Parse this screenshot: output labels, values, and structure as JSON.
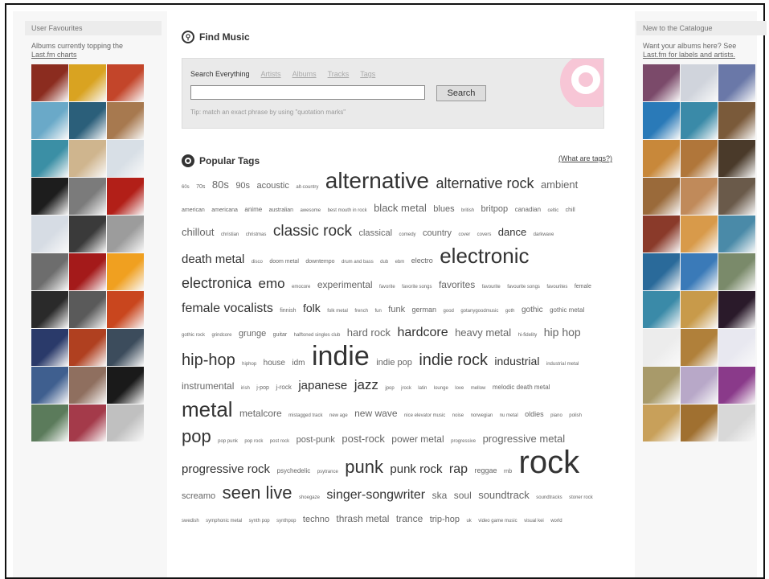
{
  "left": {
    "heading": "User Favourites",
    "text": "Albums currently topping the",
    "link": "Last.fm charts",
    "covers": [
      "#8b2c1f",
      "#d9a321",
      "#c3452a",
      "#6aa9c8",
      "#2b5f7a",
      "#a7794f",
      "#3b8fa5",
      "#cfb58e",
      "#d8dfe6",
      "#1d1d1d",
      "#7b7b7b",
      "#b21f18",
      "#d6dce4",
      "#3a3a3a",
      "#9c9c9c",
      "#6d6d6d",
      "#a41a1a",
      "#f0a020",
      "#2a2a2a",
      "#5a5a5a",
      "#c9461e",
      "#2a3a6a",
      "#b04020",
      "#3c4c5c",
      "#3f5f8f",
      "#8f6f5f",
      "#1a1a1a",
      "#5b7b5b",
      "#a43a4a",
      "#c0c0c0"
    ]
  },
  "center": {
    "find_title": "Find Music",
    "tabs": [
      "Search Everything",
      "Artists",
      "Albums",
      "Tracks",
      "Tags"
    ],
    "search_value": "",
    "search_button": "Search",
    "tip": "Tip: match an exact phrase by using \"quotation marks\"",
    "tags_title": "Popular Tags",
    "what_link": "(What are tags?)",
    "tags": [
      {
        "t": "60s",
        "s": 6
      },
      {
        "t": "70s",
        "s": 7
      },
      {
        "t": "80s",
        "s": 13
      },
      {
        "t": "90s",
        "s": 11
      },
      {
        "t": "acoustic",
        "s": 11
      },
      {
        "t": "alt-country",
        "s": 6
      },
      {
        "t": "alternative",
        "s": 28,
        "d": 1
      },
      {
        "t": "alternative rock",
        "s": 18,
        "d": 1
      },
      {
        "t": "ambient",
        "s": 13
      },
      {
        "t": "american",
        "s": 7
      },
      {
        "t": "americana",
        "s": 7
      },
      {
        "t": "anime",
        "s": 8
      },
      {
        "t": "australian",
        "s": 7
      },
      {
        "t": "awesome",
        "s": 6
      },
      {
        "t": "best mouth in rock",
        "s": 6
      },
      {
        "t": "black metal",
        "s": 13
      },
      {
        "t": "blues",
        "s": 11
      },
      {
        "t": "british",
        "s": 6
      },
      {
        "t": "britpop",
        "s": 11
      },
      {
        "t": "canadian",
        "s": 8
      },
      {
        "t": "celtic",
        "s": 6
      },
      {
        "t": "chill",
        "s": 7
      },
      {
        "t": "chillout",
        "s": 13
      },
      {
        "t": "christian",
        "s": 6
      },
      {
        "t": "christmas",
        "s": 6
      },
      {
        "t": "classic rock",
        "s": 19,
        "d": 1
      },
      {
        "t": "classical",
        "s": 11
      },
      {
        "t": "comedy",
        "s": 6
      },
      {
        "t": "country",
        "s": 11
      },
      {
        "t": "cover",
        "s": 6
      },
      {
        "t": "covers",
        "s": 6
      },
      {
        "t": "dance",
        "s": 13,
        "d": 1
      },
      {
        "t": "darkwave",
        "s": 6
      },
      {
        "t": "death metal",
        "s": 15,
        "d": 1
      },
      {
        "t": "disco",
        "s": 6
      },
      {
        "t": "doom metal",
        "s": 7
      },
      {
        "t": "downtempo",
        "s": 7
      },
      {
        "t": "drum and bass",
        "s": 6
      },
      {
        "t": "dub",
        "s": 6
      },
      {
        "t": "ebm",
        "s": 6
      },
      {
        "t": "electro",
        "s": 9
      },
      {
        "t": "electronic",
        "s": 26,
        "d": 1
      },
      {
        "t": "electronica",
        "s": 18,
        "d": 1
      },
      {
        "t": "emo",
        "s": 17,
        "d": 1
      },
      {
        "t": "emocore",
        "s": 6
      },
      {
        "t": "experimental",
        "s": 12
      },
      {
        "t": "favorite",
        "s": 6
      },
      {
        "t": "favorite songs",
        "s": 6
      },
      {
        "t": "favorites",
        "s": 12
      },
      {
        "t": "favourite",
        "s": 6
      },
      {
        "t": "favourite songs",
        "s": 6
      },
      {
        "t": "favourites",
        "s": 6
      },
      {
        "t": "female",
        "s": 7
      },
      {
        "t": "female vocalists",
        "s": 16,
        "d": 1
      },
      {
        "t": "finnish",
        "s": 7
      },
      {
        "t": "folk",
        "s": 14,
        "d": 1
      },
      {
        "t": "folk metal",
        "s": 6
      },
      {
        "t": "french",
        "s": 6
      },
      {
        "t": "fun",
        "s": 6
      },
      {
        "t": "funk",
        "s": 11
      },
      {
        "t": "german",
        "s": 9
      },
      {
        "t": "good",
        "s": 6
      },
      {
        "t": "gotanygoodmusic",
        "s": 6
      },
      {
        "t": "goth",
        "s": 6
      },
      {
        "t": "gothic",
        "s": 10
      },
      {
        "t": "gothic metal",
        "s": 8
      },
      {
        "t": "gothic rock",
        "s": 6
      },
      {
        "t": "grindcore",
        "s": 6
      },
      {
        "t": "grunge",
        "s": 11
      },
      {
        "t": "guitar",
        "s": 7
      },
      {
        "t": "halftoned singles club",
        "s": 6
      },
      {
        "t": "hard rock",
        "s": 13
      },
      {
        "t": "hardcore",
        "s": 16,
        "d": 1
      },
      {
        "t": "heavy metal",
        "s": 13
      },
      {
        "t": "hi-fidelity",
        "s": 6
      },
      {
        "t": "hip hop",
        "s": 14
      },
      {
        "t": "hip-hop",
        "s": 20,
        "d": 1
      },
      {
        "t": "hiphop",
        "s": 6
      },
      {
        "t": "house",
        "s": 10
      },
      {
        "t": "idm",
        "s": 10
      },
      {
        "t": "indie",
        "s": 34,
        "d": 1
      },
      {
        "t": "indie pop",
        "s": 11
      },
      {
        "t": "indie rock",
        "s": 20,
        "d": 1
      },
      {
        "t": "industrial",
        "s": 14,
        "d": 1
      },
      {
        "t": "industrial metal",
        "s": 6
      },
      {
        "t": "instrumental",
        "s": 12
      },
      {
        "t": "irish",
        "s": 6
      },
      {
        "t": "j-pop",
        "s": 7
      },
      {
        "t": "j-rock",
        "s": 8
      },
      {
        "t": "japanese",
        "s": 15,
        "d": 1
      },
      {
        "t": "jazz",
        "s": 17,
        "d": 1
      },
      {
        "t": "jpop",
        "s": 6
      },
      {
        "t": "jrock",
        "s": 6
      },
      {
        "t": "latin",
        "s": 6
      },
      {
        "t": "lounge",
        "s": 6
      },
      {
        "t": "love",
        "s": 6
      },
      {
        "t": "mellow",
        "s": 6
      },
      {
        "t": "melodic death metal",
        "s": 8
      },
      {
        "t": "metal",
        "s": 26,
        "d": 1
      },
      {
        "t": "metalcore",
        "s": 12
      },
      {
        "t": "mistagged track",
        "s": 6
      },
      {
        "t": "new age",
        "s": 6
      },
      {
        "t": "new wave",
        "s": 12
      },
      {
        "t": "nice elevator music",
        "s": 6
      },
      {
        "t": "noise",
        "s": 6
      },
      {
        "t": "norwegian",
        "s": 6
      },
      {
        "t": "nu metal",
        "s": 6
      },
      {
        "t": "oldies",
        "s": 9
      },
      {
        "t": "piano",
        "s": 6
      },
      {
        "t": "polish",
        "s": 6
      },
      {
        "t": "pop",
        "s": 22,
        "d": 1
      },
      {
        "t": "pop punk",
        "s": 6
      },
      {
        "t": "pop rock",
        "s": 6
      },
      {
        "t": "post rock",
        "s": 6
      },
      {
        "t": "post-punk",
        "s": 11
      },
      {
        "t": "post-rock",
        "s": 13
      },
      {
        "t": "power metal",
        "s": 12
      },
      {
        "t": "progressive",
        "s": 6
      },
      {
        "t": "progressive metal",
        "s": 13
      },
      {
        "t": "progressive rock",
        "s": 15,
        "d": 1
      },
      {
        "t": "psychedelic",
        "s": 8
      },
      {
        "t": "psytrance",
        "s": 6
      },
      {
        "t": "punk",
        "s": 22,
        "d": 1
      },
      {
        "t": "punk rock",
        "s": 15,
        "d": 1
      },
      {
        "t": "rap",
        "s": 16,
        "d": 1
      },
      {
        "t": "reggae",
        "s": 9
      },
      {
        "t": "rnb",
        "s": 7
      },
      {
        "t": "rock",
        "s": 40,
        "d": 1
      },
      {
        "t": "screamo",
        "s": 11
      },
      {
        "t": "seen live",
        "s": 22,
        "d": 1
      },
      {
        "t": "shoegaze",
        "s": 6
      },
      {
        "t": "singer-songwriter",
        "s": 16,
        "d": 1
      },
      {
        "t": "ska",
        "s": 12
      },
      {
        "t": "soul",
        "s": 12
      },
      {
        "t": "soundtrack",
        "s": 13
      },
      {
        "t": "soundtracks",
        "s": 6
      },
      {
        "t": "stoner rock",
        "s": 6
      },
      {
        "t": "swedish",
        "s": 6
      },
      {
        "t": "symphonic metal",
        "s": 6
      },
      {
        "t": "synth pop",
        "s": 6
      },
      {
        "t": "synthpop",
        "s": 6
      },
      {
        "t": "techno",
        "s": 11
      },
      {
        "t": "thrash metal",
        "s": 12
      },
      {
        "t": "trance",
        "s": 12
      },
      {
        "t": "trip-hop",
        "s": 11
      },
      {
        "t": "uk",
        "s": 6
      },
      {
        "t": "video game music",
        "s": 6
      },
      {
        "t": "visual kei",
        "s": 6
      },
      {
        "t": "world",
        "s": 6
      }
    ]
  },
  "right": {
    "heading": "New to the Catalogue",
    "text": "Want your albums here? See",
    "link": "Last.fm for labels and artists.",
    "covers": [
      "#7b4a6a",
      "#d0d4dc",
      "#6a78a8",
      "#2a7ab8",
      "#3a8aa8",
      "#7a5a3a",
      "#c8883a",
      "#b0763a",
      "#4a3a2a",
      "#9a6a3a",
      "#c08a5a",
      "#6a5a4a",
      "#8a3a2a",
      "#d89a4a",
      "#4a8aa8",
      "#2a6a9a",
      "#3a7ab8",
      "#7a8a6a",
      "#3a8aa8",
      "#c89a4a",
      "#2a1a2a",
      "#ececec",
      "#b0803a",
      "#e8e8f0",
      "#a89a6a",
      "#b8a8c8",
      "#8a3a8a",
      "#c8a05a",
      "#a07030",
      "#d8d8d8"
    ]
  }
}
